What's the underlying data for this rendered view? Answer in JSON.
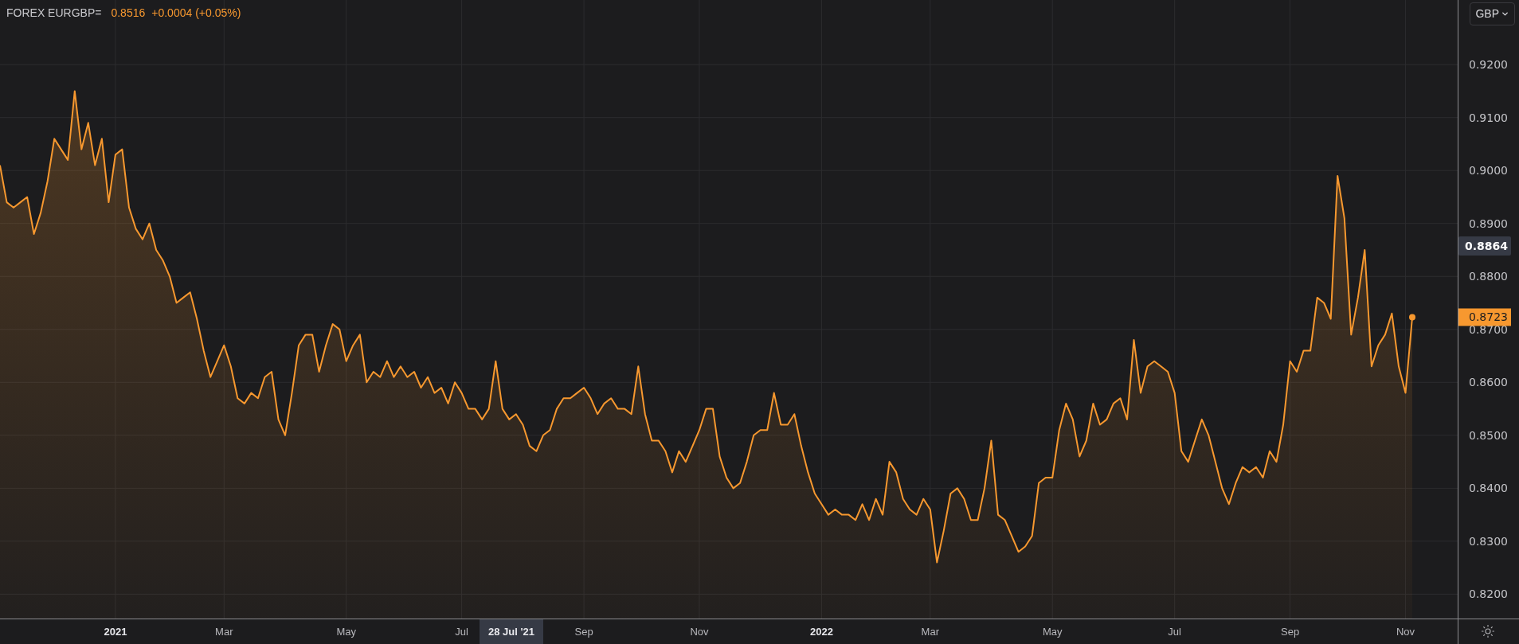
{
  "header": {
    "symbol": "FOREX EURGBP=",
    "price": "0.8516",
    "change": "+0.0004 (+0.05%)"
  },
  "currency_select": {
    "label": "GBP"
  },
  "chart": {
    "chart_data": {
      "type": "area",
      "categories": [
        null,
        null,
        null,
        null,
        null,
        null,
        null,
        null,
        null,
        null,
        null,
        null,
        null,
        null,
        null,
        null,
        null,
        "2021",
        null,
        null,
        null,
        null,
        null,
        null,
        null,
        null,
        null,
        null,
        null,
        null,
        null,
        null,
        null,
        "Mar",
        null,
        null,
        null,
        null,
        null,
        null,
        null,
        null,
        null,
        null,
        null,
        null,
        null,
        null,
        null,
        null,
        null,
        "May",
        null,
        null,
        null,
        null,
        null,
        null,
        null,
        null,
        null,
        null,
        null,
        null,
        null,
        null,
        null,
        null,
        "Jul",
        null,
        null,
        null,
        null,
        null,
        null,
        null,
        null,
        null,
        null,
        null,
        null,
        null,
        null,
        null,
        null,
        null,
        "Sep",
        null,
        null,
        null,
        null,
        null,
        null,
        null,
        null,
        null,
        null,
        null,
        null,
        null,
        null,
        null,
        null,
        "Nov",
        null,
        null,
        null,
        null,
        null,
        null,
        null,
        null,
        null,
        null,
        null,
        null,
        null,
        null,
        null,
        null,
        null,
        "2022",
        null,
        null,
        null,
        null,
        null,
        null,
        null,
        null,
        null,
        null,
        null,
        null,
        null,
        null,
        null,
        "Mar",
        null,
        null,
        null,
        null,
        null,
        null,
        null,
        null,
        null,
        null,
        null,
        null,
        null,
        null,
        null,
        null,
        null,
        "May",
        null,
        null,
        null,
        null,
        null,
        null,
        null,
        null,
        null,
        null,
        null,
        null,
        null,
        null,
        null,
        null,
        null,
        "Jul",
        null,
        null,
        null,
        null,
        null,
        null,
        null,
        null,
        null,
        null,
        null,
        null,
        null,
        null,
        null,
        null,
        "Sep",
        null,
        null,
        null,
        null,
        null,
        null,
        null,
        null,
        null,
        null,
        null,
        null,
        null,
        null,
        null,
        null,
        "Nov",
        null
      ],
      "series": [
        {
          "color": "#f7982f",
          "values": [
            0.901,
            0.894,
            0.893,
            0.894,
            0.895,
            0.888,
            0.892,
            0.898,
            0.906,
            0.904,
            0.902,
            0.915,
            0.904,
            0.909,
            0.901,
            0.906,
            0.894,
            0.903,
            0.904,
            0.893,
            0.889,
            0.887,
            0.89,
            0.885,
            0.883,
            0.88,
            0.875,
            0.876,
            0.877,
            0.872,
            0.866,
            0.861,
            0.864,
            0.867,
            0.863,
            0.857,
            0.856,
            0.858,
            0.857,
            0.861,
            0.862,
            0.853,
            0.85,
            0.858,
            0.867,
            0.869,
            0.869,
            0.862,
            0.867,
            0.871,
            0.87,
            0.864,
            0.867,
            0.869,
            0.86,
            0.862,
            0.861,
            0.864,
            0.861,
            0.863,
            0.861,
            0.862,
            0.859,
            0.861,
            0.858,
            0.859,
            0.856,
            0.86,
            0.858,
            0.855,
            0.855,
            0.853,
            0.855,
            0.864,
            0.855,
            0.853,
            0.854,
            0.852,
            0.848,
            0.847,
            0.85,
            0.851,
            0.855,
            0.857,
            0.857,
            0.858,
            0.859,
            0.857,
            0.854,
            0.856,
            0.857,
            0.855,
            0.855,
            0.854,
            0.863,
            0.854,
            0.849,
            0.849,
            0.847,
            0.843,
            0.847,
            0.845,
            0.848,
            0.851,
            0.855,
            0.855,
            0.846,
            0.842,
            0.84,
            0.841,
            0.845,
            0.85,
            0.851,
            0.851,
            0.858,
            0.852,
            0.852,
            0.854,
            0.848,
            0.843,
            0.839,
            0.837,
            0.835,
            0.836,
            0.835,
            0.835,
            0.834,
            0.837,
            0.834,
            0.838,
            0.835,
            0.845,
            0.843,
            0.838,
            0.836,
            0.835,
            0.838,
            0.836,
            0.826,
            0.832,
            0.839,
            0.84,
            0.838,
            0.834,
            0.834,
            0.84,
            0.849,
            0.835,
            0.834,
            0.831,
            0.828,
            0.829,
            0.831,
            0.841,
            0.842,
            0.842,
            0.851,
            0.856,
            0.853,
            0.846,
            0.849,
            0.856,
            0.852,
            0.853,
            0.856,
            0.857,
            0.853,
            0.868,
            0.858,
            0.863,
            0.864,
            0.863,
            0.862,
            0.858,
            0.847,
            0.845,
            0.849,
            0.853,
            0.85,
            0.845,
            0.84,
            0.837,
            0.841,
            0.844,
            0.843,
            0.844,
            0.842,
            0.847,
            0.845,
            0.852,
            0.864,
            0.862,
            0.866,
            0.866,
            0.876,
            0.875,
            0.872,
            0.899,
            0.891,
            0.869,
            0.876,
            0.885,
            0.863,
            0.867,
            0.869,
            0.873,
            0.863,
            0.858,
            0.8723
          ]
        }
      ],
      "grid": true,
      "ylim": [
        0.8154,
        0.9322
      ],
      "yticks": [
        {
          "value": 0.82,
          "label": "0.8200"
        },
        {
          "value": 0.83,
          "label": "0.8300"
        },
        {
          "value": 0.84,
          "label": "0.8400"
        },
        {
          "value": 0.85,
          "label": "0.8500"
        },
        {
          "value": 0.86,
          "label": "0.8600"
        },
        {
          "value": 0.87,
          "label": "0.8700"
        },
        {
          "value": 0.88,
          "label": "0.8800"
        },
        {
          "value": 0.89,
          "label": "0.8900"
        },
        {
          "value": 0.9,
          "label": "0.9000"
        },
        {
          "value": 0.91,
          "label": "0.9100"
        },
        {
          "value": 0.92,
          "label": "0.9200"
        }
      ]
    },
    "crosshair": {
      "date": "28 Jul '21",
      "price": "0.8864"
    },
    "last_price_label": "0.8723"
  }
}
